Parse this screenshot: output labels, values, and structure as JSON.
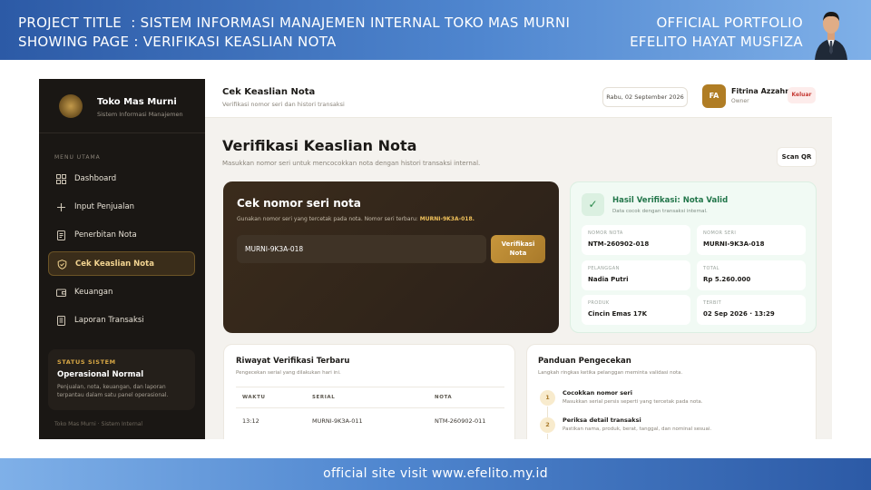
{
  "banner": {
    "project_line": "PROJECT TITLE  : SISTEM INFORMASI MANAJEMEN INTERNAL TOKO MAS MURNI",
    "page_line": "SHOWING PAGE : VERIFIKASI KEASLIAN NOTA",
    "portfolio_line": "OFFICIAL PORTFOLIO",
    "author_line": "EFELITO HAYAT MUSFIZA",
    "footer": "official site visit www.efelito.my.id"
  },
  "sidebar": {
    "brand_name": "Toko Mas Murni",
    "brand_sub": "Sistem Informasi Manajemen",
    "menu_label": "MENU UTAMA",
    "items": [
      {
        "label": "Dashboard",
        "icon": "grid-icon"
      },
      {
        "label": "Input Penjualan",
        "icon": "plus-icon"
      },
      {
        "label": "Penerbitan Nota",
        "icon": "document-icon"
      },
      {
        "label": "Cek Keaslian Nota",
        "icon": "shield-icon",
        "active": true
      },
      {
        "label": "Keuangan",
        "icon": "wallet-icon"
      },
      {
        "label": "Laporan Transaksi",
        "icon": "report-icon"
      }
    ],
    "status": {
      "title": "STATUS SISTEM",
      "main": "Operasional Normal",
      "desc": "Penjualan, nota, keuangan, dan laporan terpantau dalam satu panel operasional."
    },
    "footer": "Toko Mas Murni · Sistem Internal"
  },
  "topbar": {
    "title": "Cek Keaslian Nota",
    "subtitle": "Verifikasi nomor seri dan histori transaksi",
    "date": "Rabu, 02 September 2026",
    "user_initials": "FA",
    "user_name": "Fitrina Azzahra",
    "user_role": "Owner",
    "logout_label": "Keluar"
  },
  "page": {
    "title": "Verifikasi Keaslian Nota",
    "subtitle": "Masukkan nomor seri untuk mencocokkan nota dengan histori transaksi internal.",
    "scan_label": "Scan QR"
  },
  "check": {
    "title": "Cek nomor seri nota",
    "hint": "Gunakan nomor seri yang tercetak pada nota. Nomor seri terbaru:",
    "latest_serial": "MURNI-9K3A-018.",
    "input_value": "MURNI-9K3A-018",
    "button_line1": "Verifikasi",
    "button_line2": "Nota"
  },
  "result": {
    "title": "Hasil Verifikasi: Nota Valid",
    "subtitle": "Data cocok dengan transaksi internal.",
    "fields": [
      {
        "label": "NOMOR NOTA",
        "value": "NTM-260902-018"
      },
      {
        "label": "NOMOR SERI",
        "value": "MURNI-9K3A-018"
      },
      {
        "label": "PELANGGAN",
        "value": "Nadia Putri"
      },
      {
        "label": "TOTAL",
        "value": "Rp 5.260.000"
      },
      {
        "label": "PRODUK",
        "value": "Cincin Emas 17K"
      },
      {
        "label": "TERBIT",
        "value": "02 Sep 2026 · 13:29"
      }
    ]
  },
  "history": {
    "title": "Riwayat Verifikasi Terbaru",
    "subtitle": "Pengecekan serial yang dilakukan hari ini.",
    "columns": [
      "WAKTU",
      "SERIAL",
      "NOTA"
    ],
    "rows": [
      [
        "13:12",
        "MURNI-9K3A-011",
        "NTM-260902-011"
      ]
    ]
  },
  "guide": {
    "title": "Panduan Pengecekan",
    "subtitle": "Langkah ringkas ketika pelanggan meminta validasi nota.",
    "steps": [
      {
        "num": "1",
        "title": "Cocokkan nomor seri",
        "desc": "Masukkan serial persis seperti yang tercetak pada nota."
      },
      {
        "num": "2",
        "title": "Periksa detail transaksi",
        "desc": "Pastikan nama, produk, berat, tanggal, dan nominal sesuai."
      }
    ]
  }
}
